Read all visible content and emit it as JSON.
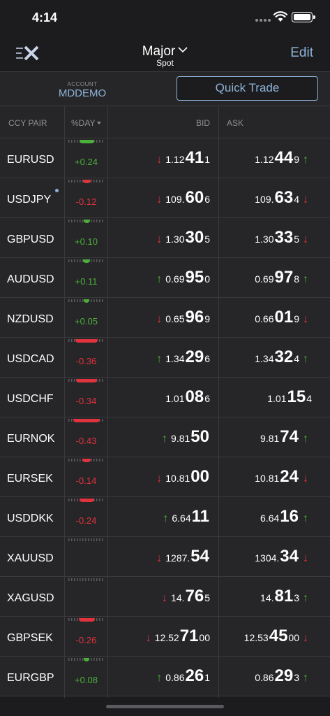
{
  "status_bar": {
    "time": "4:14"
  },
  "nav": {
    "title": "Major",
    "subtitle": "Spot",
    "edit_label": "Edit",
    "logo_icon": "fx-logo-icon"
  },
  "account": {
    "label": "ACCOUNT",
    "value": "MDDEMO",
    "quick_trade_label": "Quick Trade"
  },
  "table": {
    "headers": {
      "ccy_pair": "CCY PAIR",
      "pct_day": "%DAY",
      "bid": "BID",
      "ask": "ASK"
    },
    "rows": [
      {
        "pair": "EURUSD",
        "pct": "+0.24",
        "gauge": 0.24,
        "bid_dir": "down",
        "bid_big": "1.12",
        "bid_pips": "41",
        "bid_frac": "1",
        "ask_big": "1.12",
        "ask_pips": "44",
        "ask_frac": "9",
        "ask_dir": "up",
        "dot": false
      },
      {
        "pair": "USDJPY",
        "pct": "-0.12",
        "gauge": -0.12,
        "bid_dir": "down",
        "bid_big": "109.",
        "bid_pips": "60",
        "bid_frac": "6",
        "ask_big": "109.",
        "ask_pips": "63",
        "ask_frac": "4",
        "ask_dir": "down",
        "dot": true
      },
      {
        "pair": "GBPUSD",
        "pct": "+0.10",
        "gauge": 0.1,
        "bid_dir": "down",
        "bid_big": "1.30",
        "bid_pips": "30",
        "bid_frac": "5",
        "ask_big": "1.30",
        "ask_pips": "33",
        "ask_frac": "5",
        "ask_dir": "down",
        "dot": false
      },
      {
        "pair": "AUDUSD",
        "pct": "+0.11",
        "gauge": 0.11,
        "bid_dir": "up",
        "bid_big": "0.69",
        "bid_pips": "95",
        "bid_frac": "0",
        "ask_big": "0.69",
        "ask_pips": "97",
        "ask_frac": "8",
        "ask_dir": "up",
        "dot": false
      },
      {
        "pair": "NZDUSD",
        "pct": "+0.05",
        "gauge": 0.05,
        "bid_dir": "down",
        "bid_big": "0.65",
        "bid_pips": "96",
        "bid_frac": "9",
        "ask_big": "0.66",
        "ask_pips": "01",
        "ask_frac": "9",
        "ask_dir": "down",
        "dot": false
      },
      {
        "pair": "USDCAD",
        "pct": "-0.36",
        "gauge": -0.36,
        "bid_dir": "up",
        "bid_big": "1.34",
        "bid_pips": "29",
        "bid_frac": "6",
        "ask_big": "1.34",
        "ask_pips": "32",
        "ask_frac": "4",
        "ask_dir": "up",
        "dot": false
      },
      {
        "pair": "USDCHF",
        "pct": "-0.34",
        "gauge": -0.34,
        "bid_dir": "",
        "bid_big": "1.01",
        "bid_pips": "08",
        "bid_frac": "6",
        "ask_big": "1.01",
        "ask_pips": "15",
        "ask_frac": "4",
        "ask_dir": "",
        "dot": false
      },
      {
        "pair": "EURNOK",
        "pct": "-0.43",
        "gauge": -0.43,
        "bid_dir": "up",
        "bid_big": "9.81",
        "bid_pips": "50",
        "bid_frac": "",
        "ask_big": "9.81",
        "ask_pips": "74",
        "ask_frac": "",
        "ask_dir": "up",
        "dot": false
      },
      {
        "pair": "EURSEK",
        "pct": "-0.14",
        "gauge": -0.14,
        "bid_dir": "down",
        "bid_big": "10.81",
        "bid_pips": "00",
        "bid_frac": "",
        "ask_big": "10.81",
        "ask_pips": "24",
        "ask_frac": "",
        "ask_dir": "down",
        "dot": false
      },
      {
        "pair": "USDDKK",
        "pct": "-0.24",
        "gauge": -0.24,
        "bid_dir": "up",
        "bid_big": "6.64",
        "bid_pips": "11",
        "bid_frac": "",
        "ask_big": "6.64",
        "ask_pips": "16",
        "ask_frac": "",
        "ask_dir": "up",
        "dot": false
      },
      {
        "pair": "XAUUSD",
        "pct": "",
        "gauge": 0,
        "bid_dir": "down",
        "bid_big": "1287.",
        "bid_pips": "54",
        "bid_frac": "",
        "ask_big": "1304.",
        "ask_pips": "34",
        "ask_frac": "",
        "ask_dir": "down",
        "dot": false
      },
      {
        "pair": "XAGUSD",
        "pct": "",
        "gauge": 0,
        "bid_dir": "down",
        "bid_big": "14.",
        "bid_pips": "76",
        "bid_frac": "5",
        "ask_big": "14.",
        "ask_pips": "81",
        "ask_frac": "3",
        "ask_dir": "up",
        "dot": false
      },
      {
        "pair": "GBPSEK",
        "pct": "-0.26",
        "gauge": -0.26,
        "bid_dir": "down",
        "bid_big": "12.52",
        "bid_pips": "71",
        "bid_frac": "00",
        "ask_big": "12.53",
        "ask_pips": "45",
        "ask_frac": "00",
        "ask_dir": "down",
        "dot": false
      },
      {
        "pair": "EURGBP",
        "pct": "+0.08",
        "gauge": 0.08,
        "bid_dir": "up",
        "bid_big": "0.86",
        "bid_pips": "26",
        "bid_frac": "1",
        "ask_big": "0.86",
        "ask_pips": "29",
        "ask_frac": "3",
        "ask_dir": "up",
        "dot": false
      }
    ]
  },
  "colors": {
    "up": "#4caf3a",
    "down": "#e0333d",
    "accent": "#8fb3d9"
  }
}
